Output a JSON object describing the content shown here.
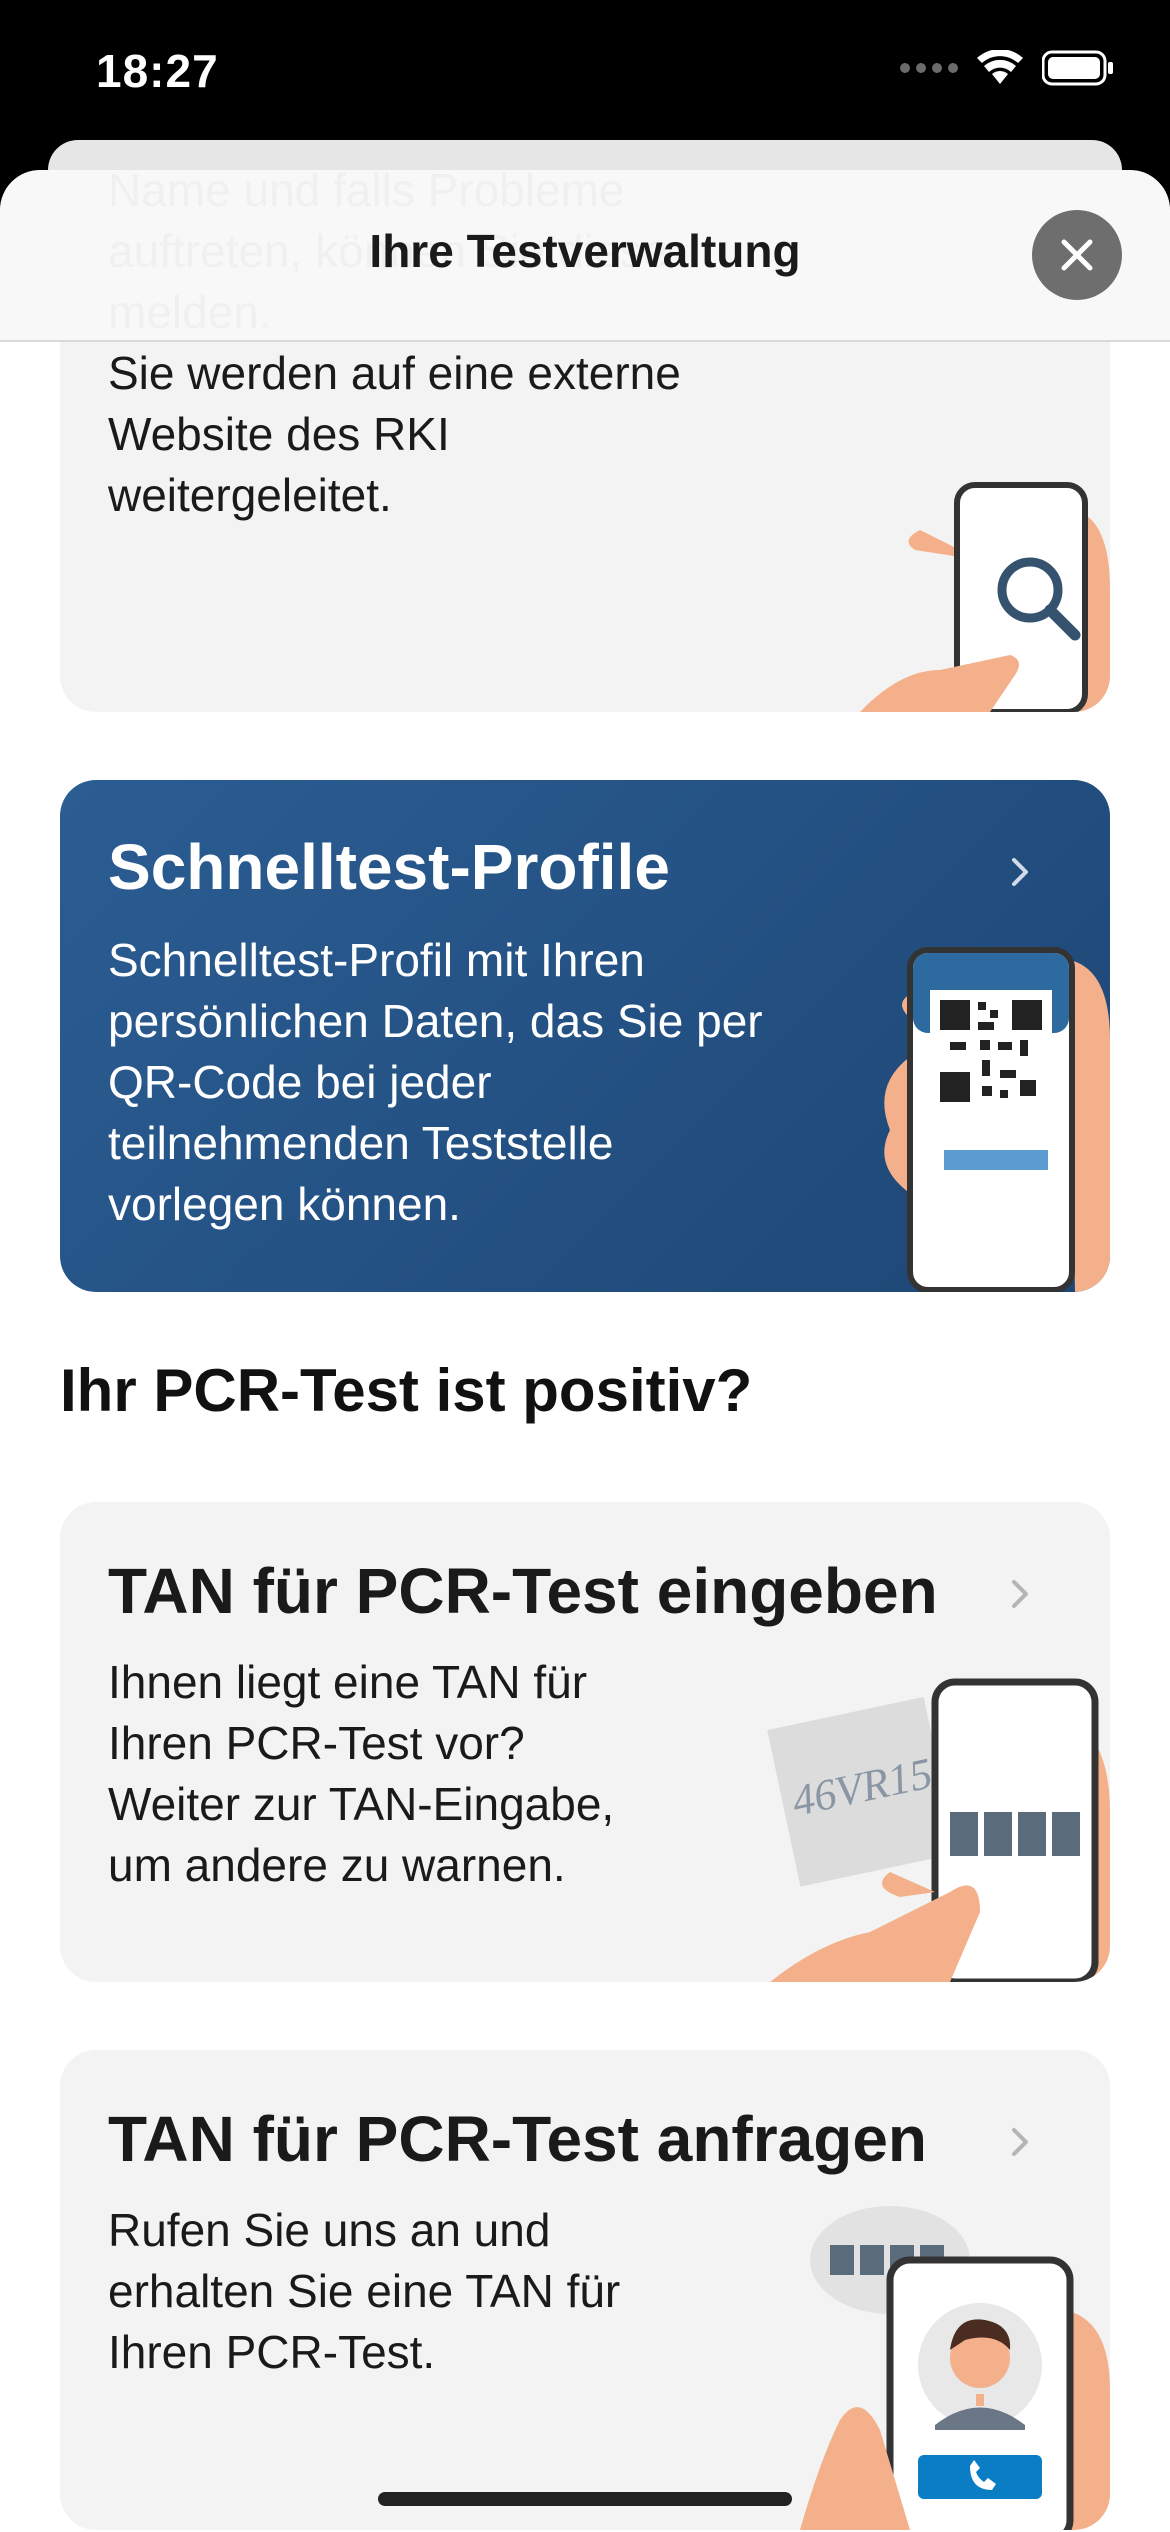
{
  "status": {
    "time": "18:27"
  },
  "nav": {
    "title": "Ihre Testverwaltung"
  },
  "card_top": {
    "body": "Name und falls Probleme\nauftreten, können Sie diese\nmelden.\nSie werden auf eine externe\nWebsite des RKI\nweitergeleitet."
  },
  "card_profile": {
    "title": "Schnelltest-Profile",
    "body": "Schnelltest-Profil mit Ihren\npersönlichen Daten, das Sie per\nQR-Code bei jeder\nteilnehmenden Teststelle\nvorlegen können."
  },
  "section": {
    "title": "Ihr PCR-Test ist positiv?"
  },
  "card_tan_enter": {
    "title": "TAN für PCR-Test eingeben",
    "body": "Ihnen liegt eine TAN für\nIhren PCR-Test vor?\nWeiter zur TAN-Eingabe,\num andere zu warnen.",
    "paper_text": "46VR15"
  },
  "card_tan_request": {
    "title": "TAN für PCR-Test anfragen",
    "body": "Rufen Sie uns an und\nerhalten Sie eine TAN für\nIhren PCR-Test."
  },
  "colors": {
    "accent_blue": "#1d4674",
    "card_gray": "#f3f3f3",
    "skin": "#f4b08a"
  }
}
